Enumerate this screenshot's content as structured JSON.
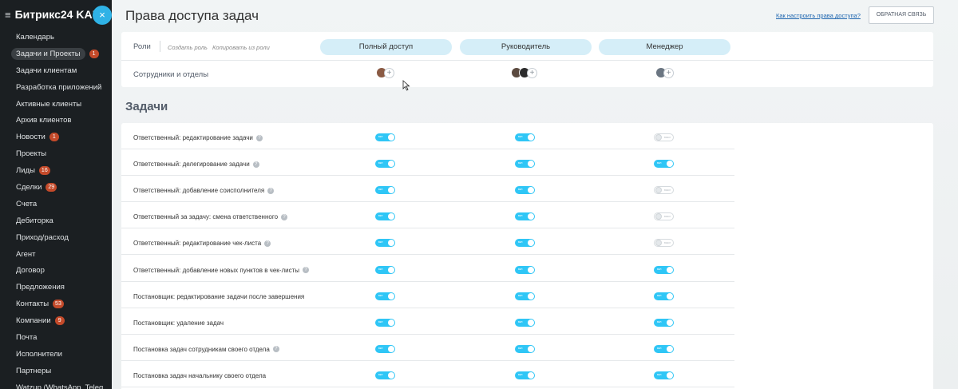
{
  "sidebar": {
    "brand": "Битрикс24 KAL",
    "close_label": "×",
    "items": [
      {
        "label": "Календарь",
        "badge": ""
      },
      {
        "label": "Задачи и Проекты",
        "badge": "1",
        "active": true
      },
      {
        "label": "Задачи клиентам",
        "badge": ""
      },
      {
        "label": "Разработка приложений",
        "badge": ""
      },
      {
        "label": "Активные клиенты",
        "badge": ""
      },
      {
        "label": "Архив клиентов",
        "badge": ""
      },
      {
        "label": "Новости",
        "badge": "1"
      },
      {
        "label": "Проекты",
        "badge": ""
      },
      {
        "label": "Лиды",
        "badge": "16"
      },
      {
        "label": "Сделки",
        "badge": "29"
      },
      {
        "label": "Счета",
        "badge": ""
      },
      {
        "label": "Дебиторка",
        "badge": ""
      },
      {
        "label": "Приход/расход",
        "badge": ""
      },
      {
        "label": "Агент",
        "badge": ""
      },
      {
        "label": "Договор",
        "badge": ""
      },
      {
        "label": "Предложения",
        "badge": ""
      },
      {
        "label": "Контакты",
        "badge": "53"
      },
      {
        "label": "Компании",
        "badge": "9"
      },
      {
        "label": "Почта",
        "badge": ""
      },
      {
        "label": "Исполнители",
        "badge": ""
      },
      {
        "label": "Партнеры",
        "badge": ""
      },
      {
        "label": "Watzup (WhatsApp, Teleg",
        "badge": ""
      }
    ]
  },
  "header": {
    "title": "Права доступа задач",
    "help_link": "Как настроить права доступа?",
    "feedback_button": "ОБРАТНАЯ СВЯЗЬ"
  },
  "roles": {
    "label": "Роли",
    "create_role": "Создать роль",
    "copy_role": "Копировать из роли",
    "columns": [
      "Полный доступ",
      "Руководитель",
      "Менеджер"
    ],
    "staff_label": "Сотрудники и отделы",
    "add_symbol": "+"
  },
  "tasks": {
    "section_title": "Задачи",
    "toggle_on_text": "вкл",
    "toggle_off_text": "выкл",
    "rows": [
      {
        "label": "Ответственный: редактирование задачи",
        "help": true,
        "values": [
          true,
          true,
          false
        ]
      },
      {
        "label": "Ответственный: делегирование задачи",
        "help": true,
        "values": [
          true,
          true,
          true
        ]
      },
      {
        "label": "Ответственный: добавление соисполнителя",
        "help": true,
        "values": [
          true,
          true,
          false
        ]
      },
      {
        "label": "Ответственный за задачу: смена ответственного",
        "help": true,
        "values": [
          true,
          true,
          false
        ]
      },
      {
        "label": "Ответственный: редактирование чек-листа",
        "help": true,
        "values": [
          true,
          true,
          false
        ]
      },
      {
        "label": "Ответственный: добавление новых пунктов в чек-листы",
        "help": true,
        "values": [
          true,
          true,
          true
        ]
      },
      {
        "label": "Постановщик: редактирование задачи после завершения",
        "help": false,
        "values": [
          true,
          true,
          true
        ]
      },
      {
        "label": "Постановщик: удаление задач",
        "help": false,
        "values": [
          true,
          true,
          true
        ]
      },
      {
        "label": "Постановка задач сотрудникам своего отдела",
        "help": true,
        "values": [
          true,
          true,
          true
        ]
      },
      {
        "label": "Постановка задач начальнику своего отдела",
        "help": false,
        "values": [
          true,
          true,
          true
        ]
      }
    ]
  },
  "colors": {
    "accent": "#2fc6f6",
    "pill": "#d5eef8",
    "sidebar": "#1b1f22",
    "badge": "#c44a2a"
  }
}
